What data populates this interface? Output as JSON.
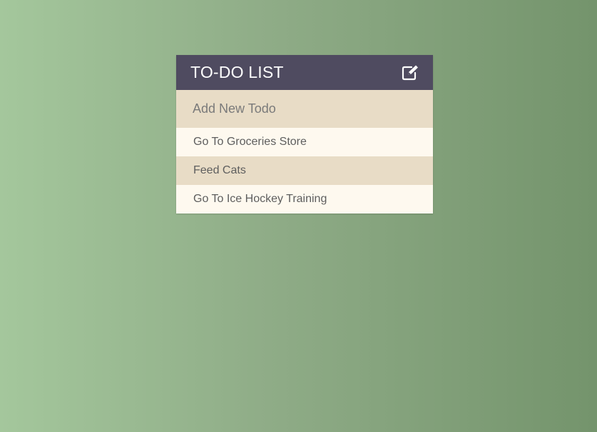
{
  "header": {
    "title": "TO-DO LIST",
    "edit_icon": "edit-icon"
  },
  "add_input": {
    "placeholder": "Add New Todo",
    "value": ""
  },
  "todos": [
    {
      "label": "Go To Groceries Store"
    },
    {
      "label": "Feed Cats"
    },
    {
      "label": "Go To Ice Hockey Training"
    }
  ],
  "colors": {
    "header_bg": "#4f4b60",
    "input_bg": "#e8dcc6",
    "item_light": "#fef9ef",
    "item_dark": "#e8dcc6",
    "bg_left": "#a4c79c",
    "bg_right": "#74946c"
  }
}
